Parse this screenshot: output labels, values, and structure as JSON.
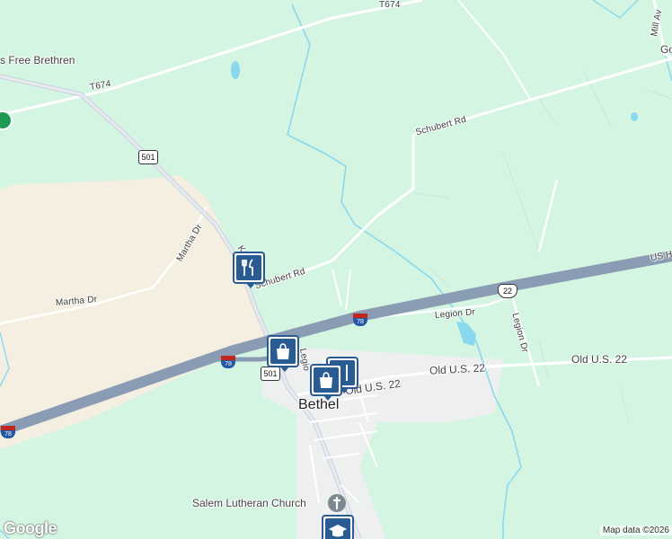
{
  "map": {
    "town_label": "Bethel",
    "places": {
      "church_top": "s Free Brethren",
      "church_bottom": "Salem Lutheran Church",
      "top_right": "Go",
      "mill_ave": "Mill Av"
    },
    "roads": {
      "t674_top": "T674",
      "t674_left": "T674",
      "schubert_rd_upper": "Schubert Rd",
      "schubert_rd_lower": "Schubert Rd",
      "martha_dr_diag": "Martha Dr",
      "martha_dr_horiz": "Martha Dr",
      "legion_dr_horiz": "Legion Dr",
      "legion_dr_vert": "Legion Dr",
      "old_us22_a": "Old U.S. 22",
      "old_us22_b": "Old U.S. 22",
      "old_us22_c": "Old U.S. 22",
      "us_highway": "US H",
      "legion_vert_short": "Legio",
      "k_label": "K"
    },
    "shields": {
      "pa501_top": "501",
      "pa501_bottom": "501",
      "us22": "22",
      "i78_a": "78",
      "i78_b": "78",
      "i78_c": "78"
    },
    "pois": [
      {
        "type": "restaurant",
        "icon": "fork-knife-icon"
      },
      {
        "type": "shopping",
        "icon": "shopping-bag-icon"
      },
      {
        "type": "shopping",
        "icon": "shopping-bag-icon"
      },
      {
        "type": "restaurant",
        "icon": "fork-knife-icon"
      },
      {
        "type": "school",
        "icon": "graduation-cap-icon"
      }
    ],
    "attribution": "Map data ©2026",
    "logo": "Google",
    "colors": {
      "land": "#d4f5e2",
      "field": "#f4efe1",
      "interstate": "#8a9bb4",
      "road": "#ffffff",
      "water": "#8ad8ee",
      "poi_pin": "#2a5c94"
    }
  }
}
